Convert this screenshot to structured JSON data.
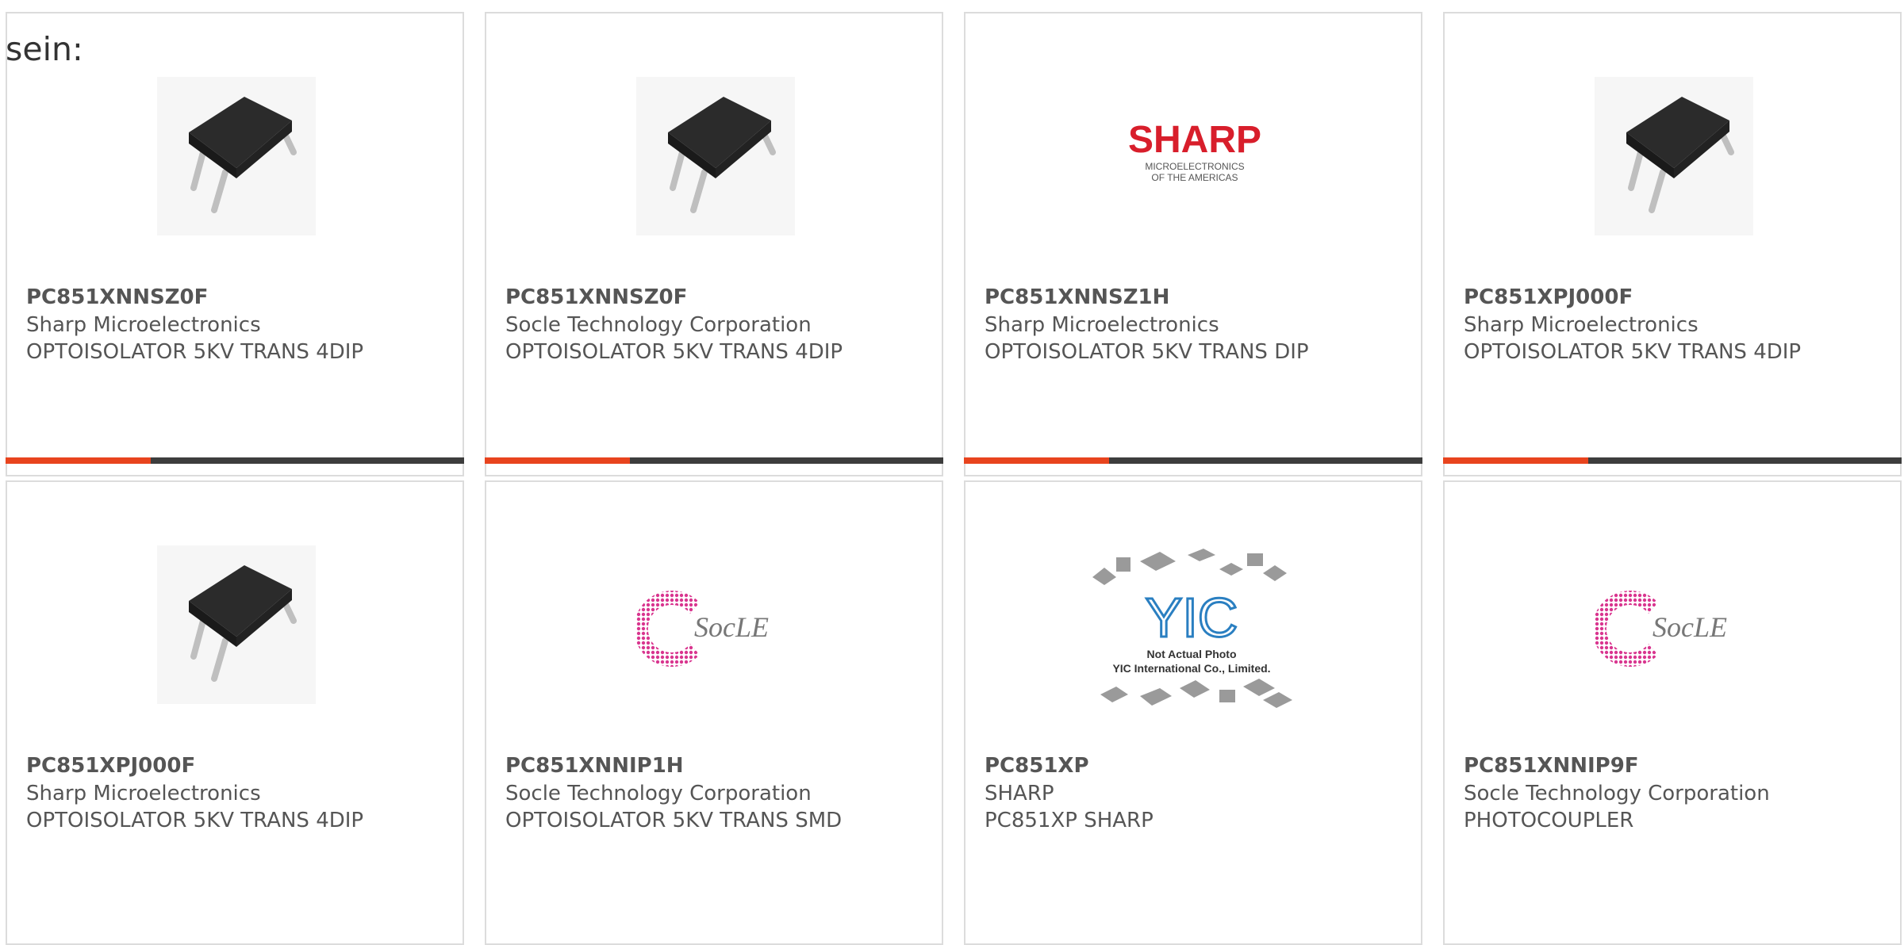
{
  "header": {
    "prefix": "sein:"
  },
  "cards": [
    {
      "part": "PC851XNNSZ0F",
      "maker": "Sharp Microelectronics",
      "desc": "OPTOISOLATOR 5KV TRANS 4DIP",
      "image": "chip-icon"
    },
    {
      "part": "PC851XNNSZ0F",
      "maker": "Socle Technology Corporation",
      "desc": "OPTOISOLATOR 5KV TRANS 4DIP",
      "image": "chip-icon"
    },
    {
      "part": "PC851XNNSZ1H",
      "maker": "Sharp Microelectronics",
      "desc": "OPTOISOLATOR 5KV TRANS DIP",
      "image": "sharp-logo",
      "logo": {
        "brand": "SHARP",
        "line1": "MICROELECTRONICS",
        "line2": "OF THE AMERICAS"
      }
    },
    {
      "part": "PC851XPJ000F",
      "maker": "Sharp Microelectronics",
      "desc": "OPTOISOLATOR 5KV TRANS 4DIP",
      "image": "chip-icon"
    },
    {
      "part": "PC851XPJ000F",
      "maker": "Sharp Microelectronics",
      "desc": "OPTOISOLATOR 5KV TRANS 4DIP",
      "image": "chip-icon"
    },
    {
      "part": "PC851XNNIP1H",
      "maker": "Socle Technology Corporation",
      "desc": "OPTOISOLATOR 5KV TRANS SMD",
      "image": "socle-logo",
      "logo": {
        "brand": "SocLE"
      }
    },
    {
      "part": "PC851XP",
      "maker": "SHARP",
      "desc": "PC851XP SHARP",
      "image": "yic-logo",
      "logo": {
        "brand": "YIC",
        "line1": "Not Actual Photo",
        "line2": "YIC International Co., Limited."
      }
    },
    {
      "part": "PC851XNNIP9F",
      "maker": "Socle Technology Corporation",
      "desc": "PHOTOCOUPLER",
      "image": "socle-logo",
      "logo": {
        "brand": "SocLE"
      }
    }
  ],
  "colors": {
    "accent": "#e8441e",
    "bar": "#3d3d3d",
    "text": "#555555",
    "border": "#dcdcdc",
    "sharp_red": "#d81e2b",
    "socle_pink": "#d9358f"
  }
}
